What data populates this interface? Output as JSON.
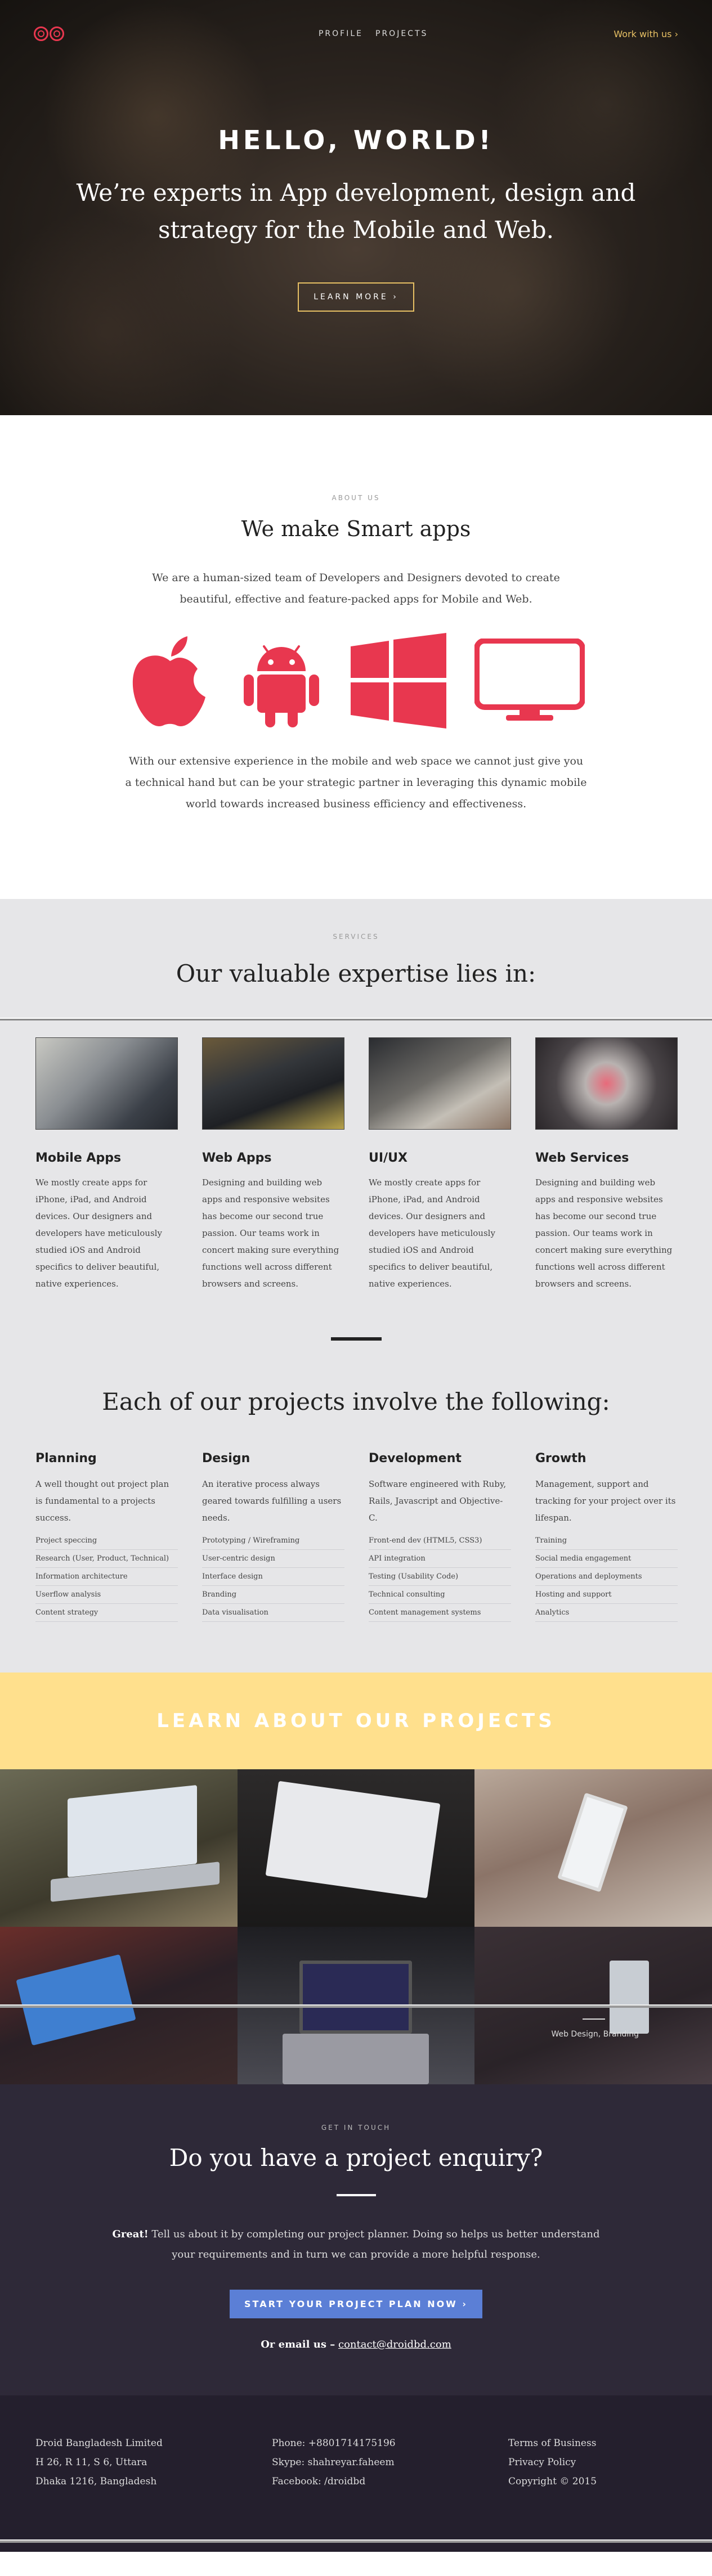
{
  "nav": {
    "links": [
      "PROFILE",
      "PROJECTS"
    ],
    "work_link": "Work with us ›",
    "logo": "droid-logo",
    "accent": "#e8374f"
  },
  "hero": {
    "title": "HELLO, WORLD!",
    "subtitle": "We’re experts in App development, design and strategy for the Mobile and Web.",
    "button": "LEARN MORE ›"
  },
  "about": {
    "kicker": "ABOUT US",
    "title": "We make Smart apps",
    "lead": "We are a human-sized team of Developers and Designers devoted to create beautiful, effective and feature-packed apps for Mobile and Web.",
    "platform_icons": [
      "apple-icon",
      "android-icon",
      "windows-icon",
      "web-icon"
    ],
    "body": "With our extensive experience in the mobile and web space we cannot just give you a technical hand but can be your strategic partner in leveraging this dynamic mobile world towards increased business efficiency and effectiveness."
  },
  "services": {
    "kicker": "SERVICES",
    "title": "Our valuable expertise lies in:",
    "items": [
      {
        "title": "Mobile Apps",
        "text": "We mostly create apps for iPhone, iPad, and Android devices. Our designers and developers have meticulously studied iOS and Android specifics to deliver beautiful, native experiences."
      },
      {
        "title": "Web Apps",
        "text": "Designing and building web apps and responsive websites has become our second true passion. Our teams work in concert making sure everything functions well across different browsers and screens."
      },
      {
        "title": "UI/UX",
        "text": "We mostly create apps for iPhone, iPad, and Android devices. Our designers and developers have meticulously studied iOS and Android specifics to deliver beautiful, native experiences."
      },
      {
        "title": "Web Services",
        "text": "Designing and building web apps and responsive websites has become our second true passion. Our teams work in concert making sure everything functions well across different browsers and screens."
      }
    ]
  },
  "process": {
    "title": "Each of our projects involve the following:",
    "phases": [
      {
        "title": "Planning",
        "desc": "A well thought out project plan is fundamental to a projects success.",
        "items": [
          "Project speccing",
          "Research (User, Product, Technical)",
          "Information architecture",
          "Userflow analysis",
          "Content strategy"
        ]
      },
      {
        "title": "Design",
        "desc": "An iterative process always geared towards fulfilling a users needs.",
        "items": [
          "Prototyping / Wireframing",
          "User-centric design",
          "Interface design",
          "Branding",
          "Data visualisation"
        ]
      },
      {
        "title": "Development",
        "desc": "Software engineered with Ruby, Rails, Javascript and Objective-C.",
        "items": [
          "Front-end dev (HTML5, CSS3)",
          "API integration",
          "Testing (Usability Code)",
          "Technical consulting",
          "Content management systems"
        ]
      },
      {
        "title": "Growth",
        "desc": "Management, support and tracking for your project over its lifespan.",
        "items": [
          "Training",
          "Social media engagement",
          "Operations and deployments",
          "Hosting and support",
          "Analytics"
        ]
      }
    ]
  },
  "band": {
    "label": "LEARN ABOUT OUR PROJECTS",
    "color": "#ffe08d"
  },
  "gallery": {
    "caption": "Web Design, Branding"
  },
  "contact": {
    "kicker": "GET IN TOUCH",
    "title": "Do you have a project enquiry?",
    "msg_bold": "Great!",
    "msg": " Tell us about it by completing our project planner. Doing so helps us better understand your requirements and in turn we can provide a more helpful response.",
    "button": "START YOUR PROJECT PLAN NOW ›",
    "email_label": "Or email us –",
    "email": "contact@droidbd.com"
  },
  "footer": {
    "address": [
      "Droid Bangladesh Limited",
      "H 26, R 11, S 6, Uttara",
      "Dhaka 1216, Bangladesh"
    ],
    "contact": [
      "Phone: +8801714175196",
      "Skype: shahreyar.faheem",
      "Facebook: /droidbd"
    ],
    "links": [
      "Terms of Business",
      "Privacy Policy",
      "Copyright © 2015"
    ]
  }
}
